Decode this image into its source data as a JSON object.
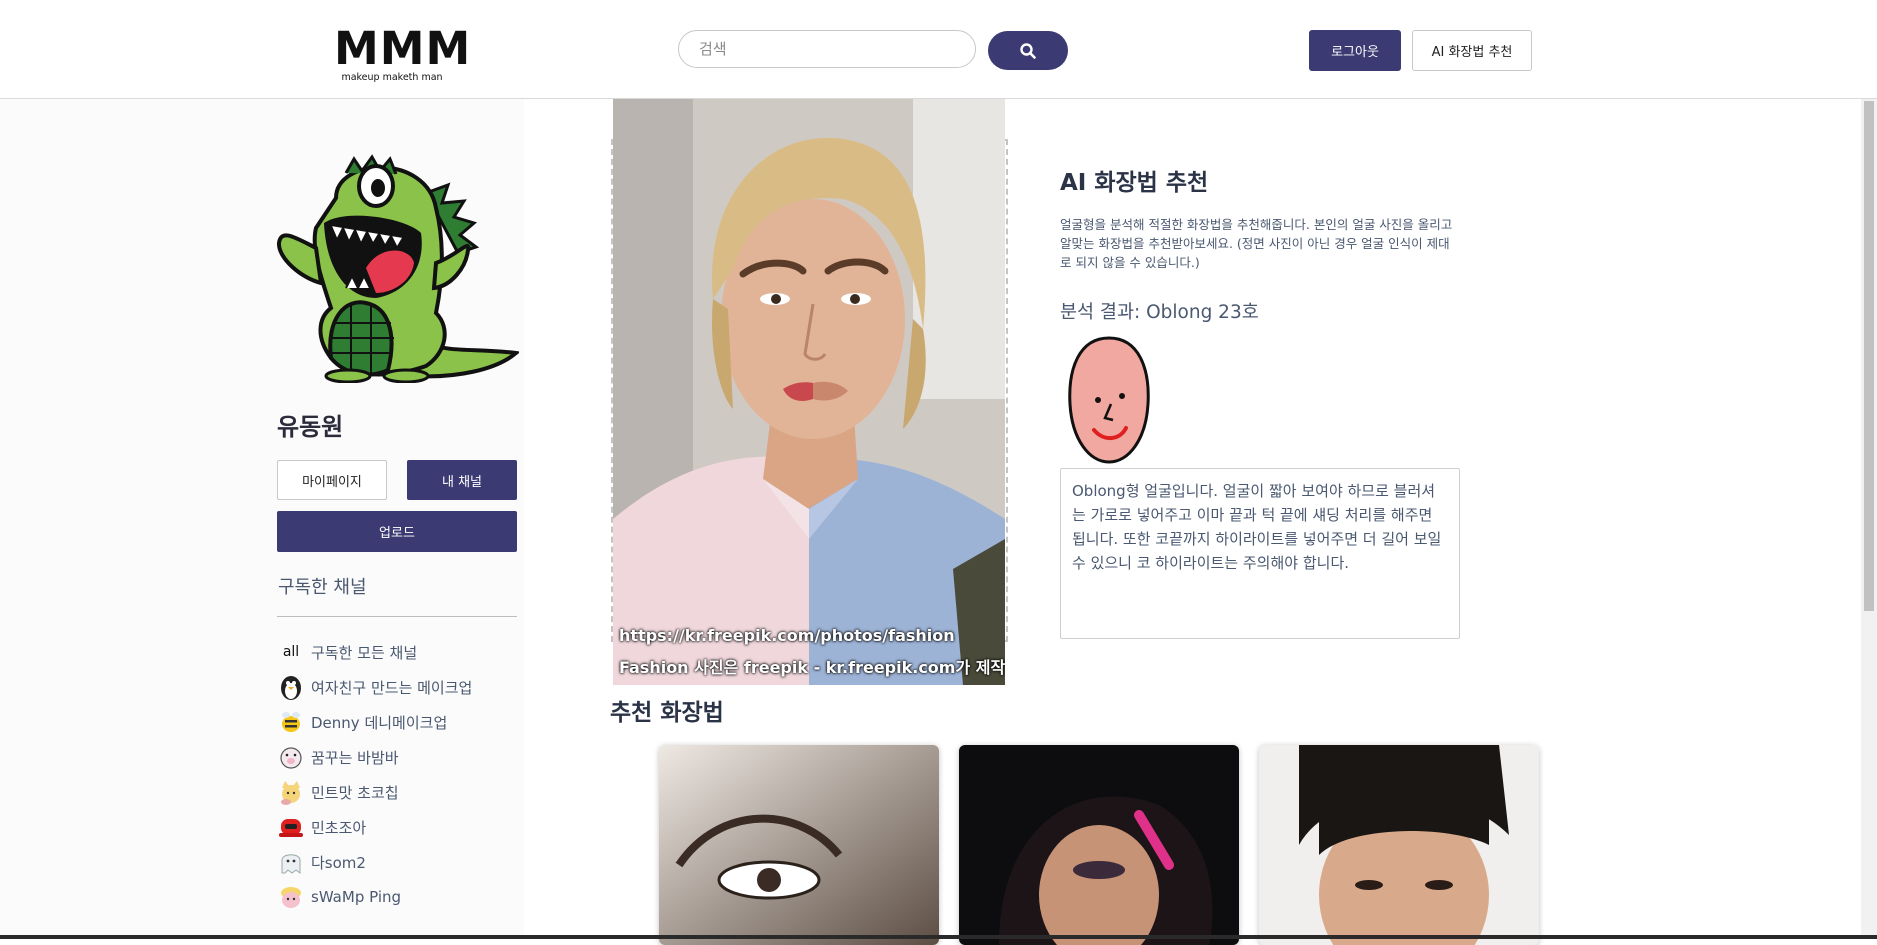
{
  "header": {
    "logo_main": "MMM",
    "logo_sub": "makeup maketh man",
    "search_placeholder": "검색",
    "logout_label": "로그아웃",
    "ai_label": "AI 화장법 추천"
  },
  "sidebar": {
    "username": "유동원",
    "mypage_label": "마이페이지",
    "mychannel_label": "내 채널",
    "upload_label": "업로드",
    "subs_title": "구독한 채널",
    "channels": [
      {
        "icon_text": "all",
        "icon": "all-text-icon",
        "label": "구독한 모든 채널"
      },
      {
        "icon_text": "",
        "icon": "penguin-icon",
        "label": "여자친구 만드는 메이크업"
      },
      {
        "icon_text": "",
        "icon": "bee-icon",
        "label": "Denny 데니메이크업"
      },
      {
        "icon_text": "",
        "icon": "pig-icon",
        "label": "꿈꾸는 바밤바"
      },
      {
        "icon_text": "",
        "icon": "cat-icon",
        "label": "민트맛 초코칩"
      },
      {
        "icon_text": "",
        "icon": "red-robot-icon",
        "label": "민초조아"
      },
      {
        "icon_text": "",
        "icon": "ghost-icon",
        "label": "다som2"
      },
      {
        "icon_text": "",
        "icon": "pink-creature-icon",
        "label": "sWaMp Ping"
      }
    ]
  },
  "main": {
    "photo_caption_1": "https://kr.freepik.com/photos/fashion",
    "photo_caption_2": "Fashion 사진은 freepik - kr.freepik.com가 제작함",
    "ai_title": "AI 화장법 추천",
    "ai_desc": "얼굴형을 분석해 적절한 화장법을 추천해줍니다. 본인의 얼굴 사진을 올리고 알맞는 화장법을 추천받아보세요. (정면 사진이 아닌 경우 얼굴 인식이 제대로 되지 않을 수 있습니다.)",
    "result_text": "분석 결과: Oblong 23호",
    "analysis_text": "Oblong형 얼굴입니다. 얼굴이 짧아 보여야 하므로 블러셔는 가로로 넣어주고 이마 끝과 턱 끝에 섀딩 처리를 해주면 됩니다. 또한 코끝까지 하이라이트를 넣어주면 더 길어 보일 수 있으니 코 하이라이트는 주의해야 합니다.",
    "rec_title": "추천 화장법"
  },
  "colors": {
    "accent": "#3b3a72",
    "text_muted": "#4a5870",
    "heading": "#2b3347"
  }
}
